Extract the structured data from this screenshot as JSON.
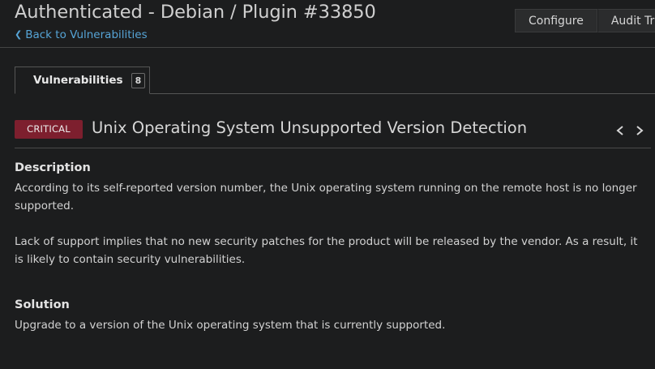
{
  "header": {
    "title": "Authenticated - Debian / Plugin #33850",
    "back_link": "Back to Vulnerabilities"
  },
  "toolbar": {
    "configure_label": "Configure",
    "audit_trail_label": "Audit Trail"
  },
  "tabs": [
    {
      "label": "Vulnerabilities",
      "count": "8"
    }
  ],
  "vulnerability": {
    "severity": "CRITICAL",
    "severity_color": "#7d1f2e",
    "title": "Unix Operating System Unsupported Version Detection",
    "prev_icon": "chevron-left-icon",
    "next_icon": "chevron-right-icon"
  },
  "description": {
    "heading": "Description",
    "paragraph_1": "According to its self-reported version number, the Unix operating system running on the remote host is no longer supported.",
    "paragraph_2": "Lack of support implies that no new security patches for the product will be released by the vendor. As a result, it is likely to contain security vulnerabilities."
  },
  "solution": {
    "heading": "Solution",
    "text": "Upgrade to a version of the Unix operating system that is currently supported."
  },
  "colors": {
    "background": "#1c1d1e",
    "link": "#56a4d6",
    "critical": "#7d1f2e"
  }
}
